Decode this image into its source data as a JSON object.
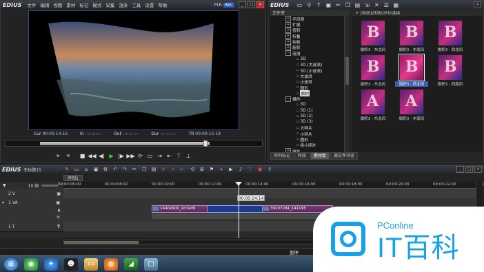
{
  "player": {
    "app_name": "EDIUS",
    "menu": [
      "文件",
      "编辑",
      "视图",
      "素材",
      "标记",
      "模式",
      "采集",
      "渲染",
      "工具",
      "设置",
      "帮助"
    ],
    "plr_label": "PLR",
    "rec_label": "REC",
    "timecodes": {
      "cur_label": "Cur",
      "cur_value": "00:00:14:16",
      "in_label": "In",
      "in_value": "--:--:--:--",
      "out_label": "Out",
      "out_value": "--:--:--:--",
      "dur_label": "Dur",
      "dur_value": "--:--:--:--",
      "ttl_label": "Ttl",
      "ttl_value": "00:00:15:19"
    },
    "seek_position": 0.78
  },
  "library": {
    "header_left": "文件夹",
    "header_right": "[特效]\\转场\\GPU\\连续",
    "tree": [
      {
        "label": "手风琴",
        "type": "folder",
        "expanded": false
      },
      {
        "label": "扩展",
        "type": "folder",
        "expanded": false
      },
      {
        "label": "扭转",
        "type": "folder",
        "expanded": false
      },
      {
        "label": "折叠",
        "type": "folder",
        "expanded": false
      },
      {
        "label": "拍板",
        "type": "folder",
        "expanded": false
      },
      {
        "label": "旋转",
        "type": "folder",
        "expanded": false
      },
      {
        "label": "涟漪",
        "type": "folder",
        "expanded": true
      },
      {
        "label": "3D",
        "type": "leaf"
      },
      {
        "label": "3D (大波浪)",
        "type": "leaf"
      },
      {
        "label": "3D (小波浪)",
        "type": "leaf"
      },
      {
        "label": "大波浪",
        "type": "leaf"
      },
      {
        "label": "小波浪",
        "type": "leaf"
      },
      {
        "label": "圆形",
        "type": "leaf"
      },
      {
        "label": "旗帜",
        "type": "leaf",
        "selected": true
      },
      {
        "label": "爆炸",
        "type": "folder",
        "expanded": true
      },
      {
        "label": "3D",
        "type": "leaf"
      },
      {
        "label": "3D (1)",
        "type": "leaf"
      },
      {
        "label": "3D (2)",
        "type": "leaf"
      },
      {
        "label": "3D (3)",
        "type": "leaf"
      },
      {
        "label": "大碎片",
        "type": "leaf"
      },
      {
        "label": "小碎片",
        "type": "leaf"
      },
      {
        "label": "圆形",
        "type": "leaf"
      },
      {
        "label": "极小碎片",
        "type": "leaf"
      },
      {
        "label": "球化",
        "type": "folder",
        "expanded": false
      },
      {
        "label": "四边形高级",
        "type": "folder",
        "expanded": false
      }
    ],
    "effects": [
      {
        "glyph": "B",
        "label": "旗帜3 - 东北风"
      },
      {
        "glyph": "B",
        "label": "旗帜3 - 东南风"
      },
      {
        "glyph": "B",
        "label": "旗帜3 - 西北风"
      },
      {
        "glyph": "B",
        "label": "旗帜3 - 东北风"
      },
      {
        "glyph": "B",
        "label": "旗帜3 - 西北风",
        "selected": true
      },
      {
        "glyph": "B",
        "label": "旗帜3 - 西南风"
      },
      {
        "glyph": "A",
        "label": "旗帜3 - 东北风"
      },
      {
        "glyph": "A",
        "label": "旗帜3 - 东南风"
      }
    ],
    "tabs": [
      {
        "label": "序列标记",
        "active": false
      },
      {
        "label": "特效",
        "active": false
      },
      {
        "label": "素材库",
        "active": true
      },
      {
        "label": "源文件浏览",
        "active": false
      }
    ]
  },
  "timeline": {
    "app_name": "EDIUS",
    "project_name": "无标题15",
    "sequence_tab": "序列1",
    "ruler_ticks": [
      "00:00:06:00",
      "00:00:08:00",
      "00:00:10:00",
      "00:00:12:00",
      "00:00:14:00",
      "00:00:16:00",
      "00:00:18:00",
      "00:00:20:00",
      "00:00:22:00",
      "00:00:24:00"
    ],
    "tracks": [
      {
        "id": "scale",
        "label": "10 帧"
      },
      {
        "id": "2V",
        "label": "2 V"
      },
      {
        "id": "1VA",
        "label": "1 VA"
      },
      {
        "id": "1T",
        "label": "1 T"
      }
    ],
    "clips": [
      {
        "label": "1440x900_2d7ed9",
        "track": "1VA"
      },
      {
        "label": "",
        "track": "1VA",
        "kind": "transition"
      },
      {
        "label": "39107284_141195",
        "track": "1VA"
      }
    ],
    "playhead_tc": "00:00:14:14",
    "status_text": "暂停"
  },
  "taskbar": {
    "icons": [
      "windows-start-icon",
      "browser-globe-icon",
      "chrome-icon",
      "qq-penguin-icon",
      "file-explorer-icon",
      "firefox-icon",
      "edius-app-icon",
      "window-icon"
    ]
  },
  "watermark": {
    "brand": "PConline",
    "big_text": "IT百科"
  },
  "colors": {
    "accent_blue": "#1aa0e6",
    "clip_purple": "#7a3a7a",
    "transition_blue": "#1f3a8c",
    "play_green": "#3ecf3e"
  }
}
